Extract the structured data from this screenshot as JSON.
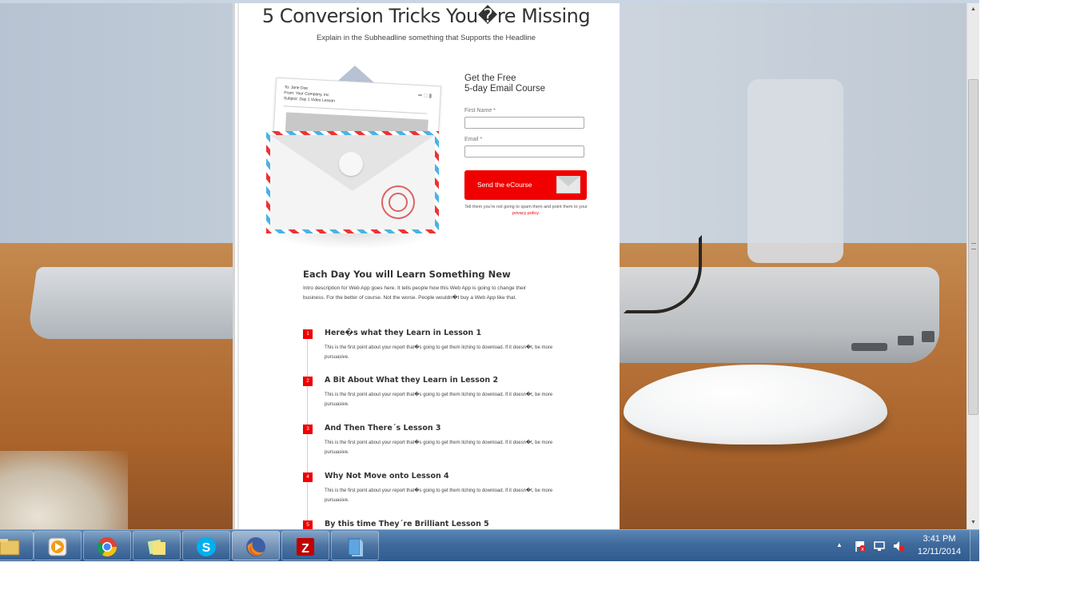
{
  "page": {
    "headline": "5 Conversion Tricks You�re Missing",
    "subheadline": "Explain in the Subheadline something that Supports the Headline"
  },
  "illustration": {
    "to": "To: Jane Doe",
    "from": "From: Your Company, Inc",
    "subject": "Subject: Day 1 Video Lesson"
  },
  "form": {
    "title_line1": "Get the Free",
    "title_line2": "5-day Email Course",
    "first_name_label": "First Name *",
    "email_label": "Email *",
    "cta_label": "Send the eCourse",
    "spam_note": "Tell them you're not going to spam them and point them to your",
    "spam_link": "privacy policy",
    "spam_end": "."
  },
  "lessons_section": {
    "title": "Each Day You will Learn Something New",
    "intro": "Intro description for Web App goes here. It tells people how this Web App is going to change their business. For the better of course. Not the worse. People wouldn�t buy a Web App like that.",
    "lessons": [
      {
        "num": "1",
        "title": "Here�s what they Learn in Lesson 1",
        "desc": "This is the first point about your report that�s going to get them itching to download. If it doesn�t, be more pursuasive."
      },
      {
        "num": "2",
        "title": "A Bit About What they Learn in Lesson 2",
        "desc": "This is the first point about your report that�s going to get them itching to download. If it doesn�t, be more pursuasive."
      },
      {
        "num": "3",
        "title": "And Then There´s Lesson 3",
        "desc": "This is the first point about your report that�s going to get them itching to download. If it doesn�t, be more pursuasive."
      },
      {
        "num": "4",
        "title": "Why Not Move onto Lesson 4",
        "desc": "This is the first point about your report that�s going to get them itching to download. If it doesn�t, be more pursuasive."
      },
      {
        "num": "5",
        "title": "By this time They´re Brilliant Lesson 5",
        "desc": ""
      }
    ]
  },
  "taskbar": {
    "apps": [
      {
        "name": "file-explorer-icon",
        "active": false
      },
      {
        "name": "media-player-icon",
        "active": false
      },
      {
        "name": "chrome-icon",
        "active": false
      },
      {
        "name": "sticky-notes-icon",
        "active": false
      },
      {
        "name": "skype-icon",
        "active": false
      },
      {
        "name": "firefox-icon",
        "active": true
      },
      {
        "name": "filezilla-icon",
        "active": false
      },
      {
        "name": "document-app-icon",
        "active": false
      }
    ],
    "clock_time": "3:41 PM",
    "clock_date": "12/11/2014"
  },
  "colors": {
    "accent_red": "#f00000",
    "taskbar_blue": "#3f6a9c"
  }
}
